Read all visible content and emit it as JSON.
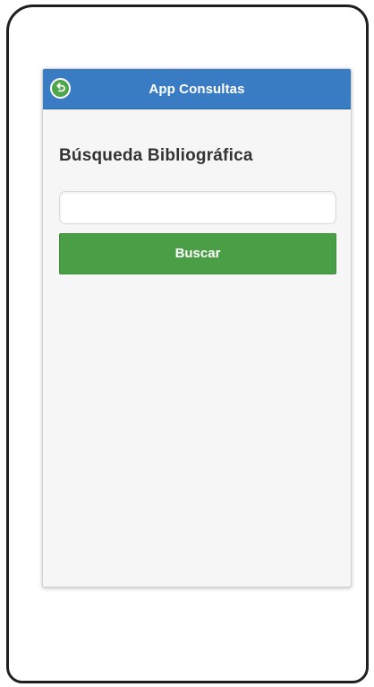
{
  "header": {
    "title": "App Consultas",
    "back_icon": "back-arrow-icon"
  },
  "main": {
    "heading": "Búsqueda Bibliográfica",
    "search": {
      "value": "",
      "placeholder": ""
    },
    "search_button_label": "Buscar"
  },
  "colors": {
    "header_bg": "#3a7cc4",
    "accent_green": "#4a9e45",
    "screen_bg": "#f6f6f6"
  }
}
